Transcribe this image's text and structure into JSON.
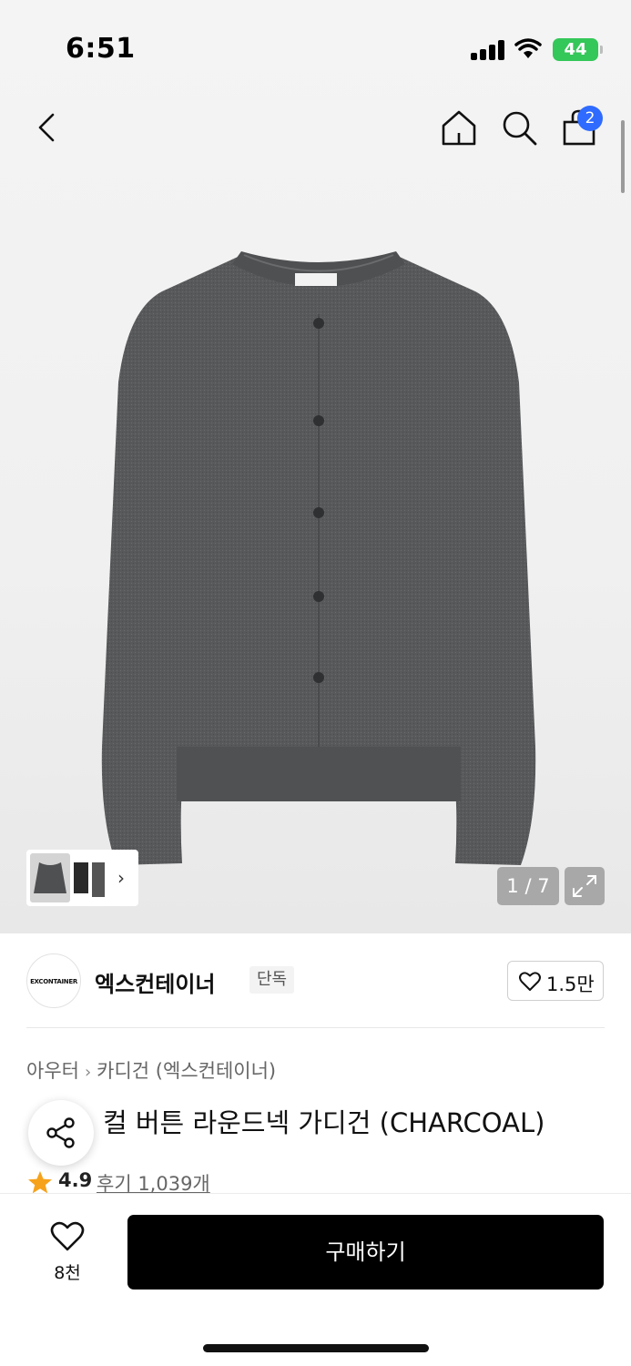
{
  "status_bar": {
    "time": "6:51",
    "battery": "44",
    "icons": [
      "cellular-signal-icon",
      "wifi-icon",
      "battery-charging-icon"
    ]
  },
  "nav": {
    "icons": [
      "chevron-left-icon",
      "home-icon",
      "search-icon",
      "shopping-bag-icon"
    ],
    "cart_count": "2"
  },
  "gallery": {
    "counter": "1 / 7",
    "icons": [
      "garment-thumbnails",
      "chevron-right-icon",
      "expand-icon"
    ]
  },
  "brand": {
    "logo_text": "EXCONTAINER",
    "name": "엑스컨테이너",
    "badge": "단독",
    "like_count": "1.5만"
  },
  "breadcrumb": {
    "items": [
      "아우터",
      "카디건 (엑스컨테이너)"
    ]
  },
  "product": {
    "title": "D 헤어리 컬 버튼 라운드넥 가디건 (CHARCOAL)",
    "title_visible": "         컬 버튼 라운드넥 가디건 (CHARCOAL)",
    "rating": "4.9",
    "reviews": "후기 1,039개"
  },
  "action_bar": {
    "wish_count": "8천",
    "buy_label": "구매하기"
  },
  "colors": {
    "cart_badge": "#2f6bff",
    "battery": "#34c759",
    "star": "#f7a21b",
    "buy_button": "#000000"
  }
}
